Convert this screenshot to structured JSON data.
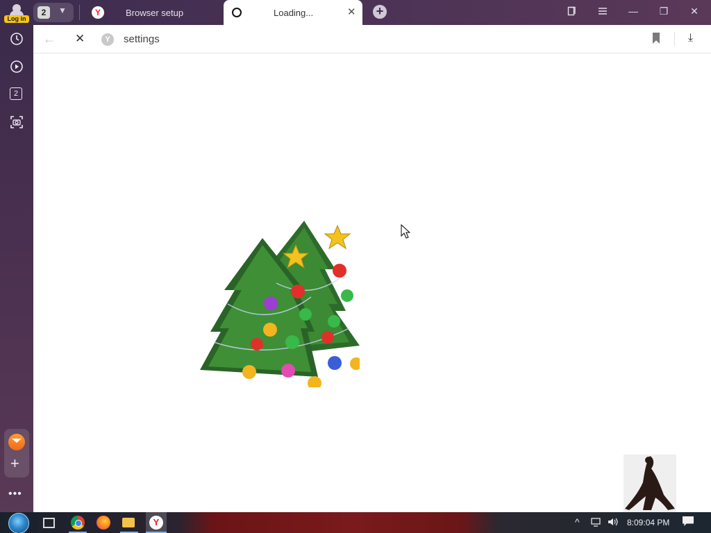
{
  "titlebar": {
    "login_label": "Log in",
    "tab_count": "2",
    "tabs": [
      {
        "label": "Browser setup",
        "icon": "yandex-logo-icon"
      },
      {
        "label": "Loading...",
        "icon": "loading-spinner-icon",
        "close": "✕"
      }
    ],
    "new_tab_symbol": "+",
    "window_controls": {
      "minimize": "—",
      "restore": "❐",
      "close": "✕"
    }
  },
  "sidebar": {
    "items": [
      {
        "icon": "history-clock-icon"
      },
      {
        "icon": "play-video-icon"
      },
      {
        "icon": "tab-count-icon",
        "label": "2"
      },
      {
        "icon": "screenshot-camera-icon"
      }
    ],
    "dock": {
      "mail_icon": "yandex-mail-icon",
      "add_symbol": "+"
    },
    "more_symbol": "•••"
  },
  "addressbar": {
    "back_symbol": "←",
    "stop_symbol": "✕",
    "site_badge": "Y",
    "url": "settings",
    "bookmark_icon": "bookmark-icon",
    "download_symbol": "⤓"
  },
  "content": {
    "illustration": "christmas-trees-image",
    "sticker": "sticker-image"
  },
  "taskbar": {
    "apps": [
      "start-button",
      "task-view-icon",
      "chrome-icon",
      "firefox-icon",
      "file-explorer-icon",
      "yandex-browser-icon"
    ],
    "yandex_letter": "Y",
    "tray_chevron": "^",
    "time": "8:09:04 PM"
  }
}
